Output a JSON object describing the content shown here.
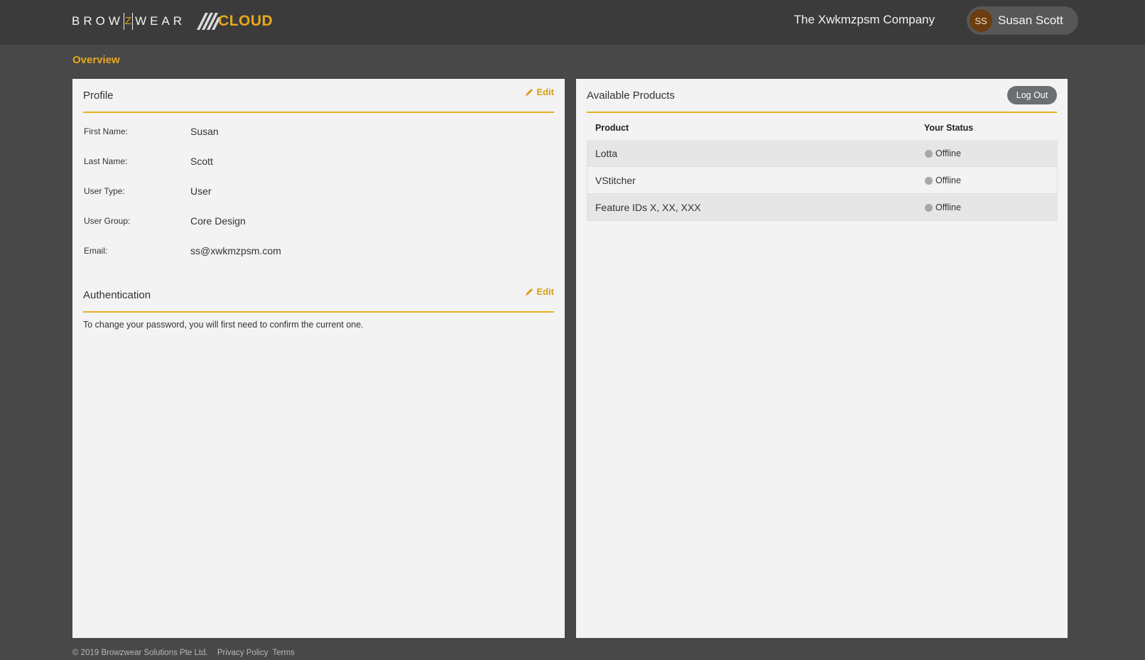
{
  "header": {
    "brand_left": "BROW",
    "brand_z": "Z",
    "brand_right": "WEAR",
    "cloud": "CLOUD",
    "company": "The Xwkmzpsm Company",
    "user_initials": "SS",
    "user_name": "Susan Scott"
  },
  "page": {
    "title": "Overview"
  },
  "profile": {
    "title": "Profile",
    "edit": "Edit",
    "fields": [
      {
        "label": "First Name:",
        "value": "Susan"
      },
      {
        "label": "Last Name:",
        "value": "Scott"
      },
      {
        "label": "User Type:",
        "value": "User"
      },
      {
        "label": "User Group:",
        "value": "Core Design"
      },
      {
        "label": "Email:",
        "value": "ss@xwkmzpsm.com"
      }
    ]
  },
  "authentication": {
    "title": "Authentication",
    "edit": "Edit",
    "text": "To change your password, you will first need to confirm the current one."
  },
  "products": {
    "title": "Available Products",
    "logout": "Log Out",
    "col_product": "Product",
    "col_status": "Your Status",
    "rows": [
      {
        "product": "Lotta",
        "status": "Offline"
      },
      {
        "product": "VStitcher",
        "status": "Offline"
      },
      {
        "product": "Feature IDs X, XX, XXX",
        "status": "Offline"
      }
    ]
  },
  "footer": {
    "copyright": "© 2019 Browzwear Solutions Pte Ltd.",
    "privacy": "Privacy Policy",
    "terms": "Terms"
  },
  "colors": {
    "accent": "#e8a81c",
    "topbar": "#3b3b3b",
    "background": "#484848",
    "panel": "#f3f3f3"
  }
}
